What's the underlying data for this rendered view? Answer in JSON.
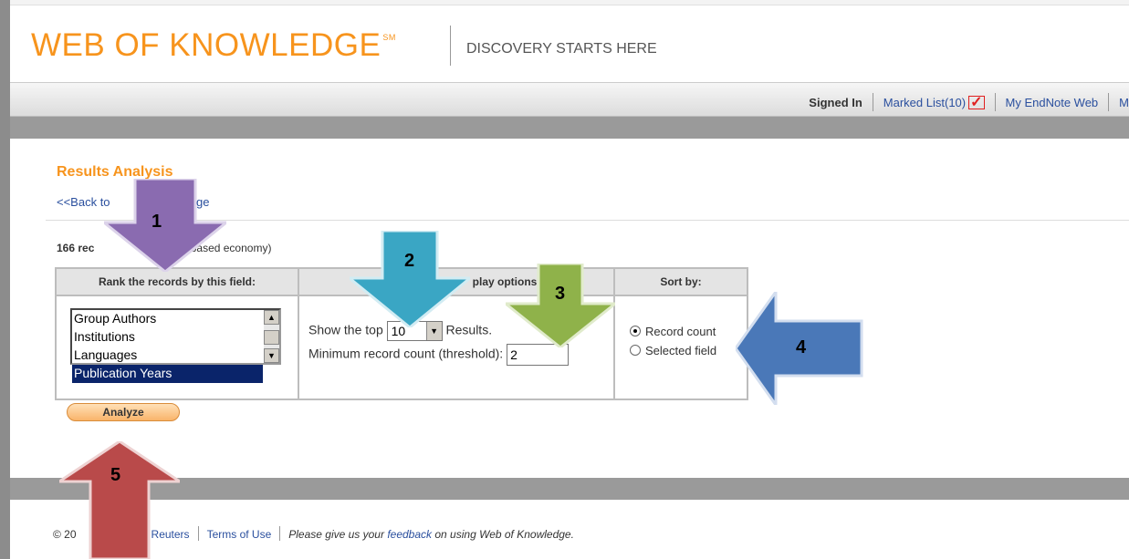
{
  "header": {
    "logo": "WEB OF KNOWLEDGE",
    "logo_mark": "SM",
    "tagline": "DISCOVERY STARTS HERE"
  },
  "nav": {
    "signed_in": "Signed In",
    "marked_list": "Marked List(10)",
    "endnote": "My EndNote Web",
    "more": "M"
  },
  "page": {
    "title": "Results Analysis",
    "back_link": "<<Back to",
    "back_link_end": "page",
    "records_count": "166 rec",
    "records_query": "nt based economy)"
  },
  "table": {
    "col_rank": "Rank the records by this field:",
    "col_display": "play options:",
    "col_sort": "Sort by:",
    "fields": [
      "Group Authors",
      "Institutions",
      "Languages",
      "Publication Years"
    ],
    "selected_field": "Publication Years",
    "show_top_prefix": "Show the top",
    "show_top_value": "10",
    "show_top_suffix": "Results.",
    "threshold_label": "Minimum record count (threshold):",
    "threshold_value": "2",
    "sort_record_count": "Record count",
    "sort_selected_field": "Selected field",
    "sort_selected": "Record count"
  },
  "analyze_label": "Analyze",
  "footer": {
    "copyright": "© 20",
    "reuters": "n Reuters",
    "terms": "Terms of Use",
    "feedback_pre": "Please give us your",
    "feedback_link": "feedback",
    "feedback_post": "on using Web of Knowledge."
  },
  "callouts": {
    "one": "1",
    "two": "2",
    "three": "3",
    "four": "4",
    "five": "5",
    "colors": {
      "one": "#8a6bb0",
      "two": "#3aa6c4",
      "three": "#8fb24a",
      "four": "#4a78b8",
      "five": "#b94a4a"
    }
  },
  "colors": {
    "brand_orange": "#f7941d",
    "link_blue": "#2a4f9e",
    "selection": "#0a246a"
  }
}
